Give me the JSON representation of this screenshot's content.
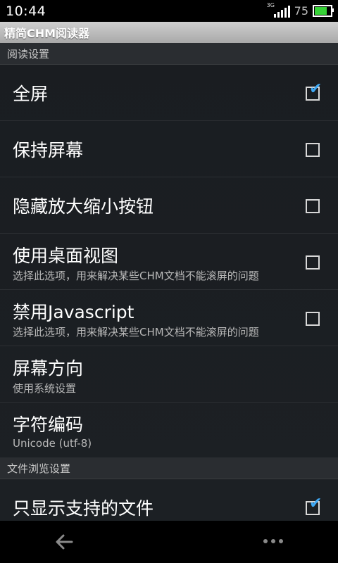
{
  "status": {
    "time": "10:44",
    "network": "3G",
    "battery_level": "75",
    "battery_color": "#37d237"
  },
  "app": {
    "title": "精简CHM阅读器"
  },
  "sections": [
    {
      "header": "阅读设置",
      "items": [
        {
          "title": "全屏",
          "summary": "",
          "checked": true
        },
        {
          "title": "保持屏幕",
          "summary": "",
          "checked": false
        },
        {
          "title": "隐藏放大缩小按钮",
          "summary": "",
          "checked": false
        },
        {
          "title": "使用桌面视图",
          "summary": "选择此选项，用来解决某些CHM文档不能滚屏的问题",
          "checked": false
        },
        {
          "title": "禁用Javascript",
          "summary": "选择此选项，用来解决某些CHM文档不能滚屏的问题",
          "checked": false
        },
        {
          "title": "屏幕方向",
          "summary": "使用系统设置"
        },
        {
          "title": "字符编码",
          "summary": "Unicode (utf-8)"
        }
      ]
    },
    {
      "header": "文件浏览设置",
      "items": [
        {
          "title": "只显示支持的文件",
          "summary": "",
          "checked": true
        }
      ]
    }
  ],
  "icons": {
    "check_color": "#3fa9f5",
    "back": "back-arrow-icon",
    "menu": "overflow-menu-icon"
  }
}
